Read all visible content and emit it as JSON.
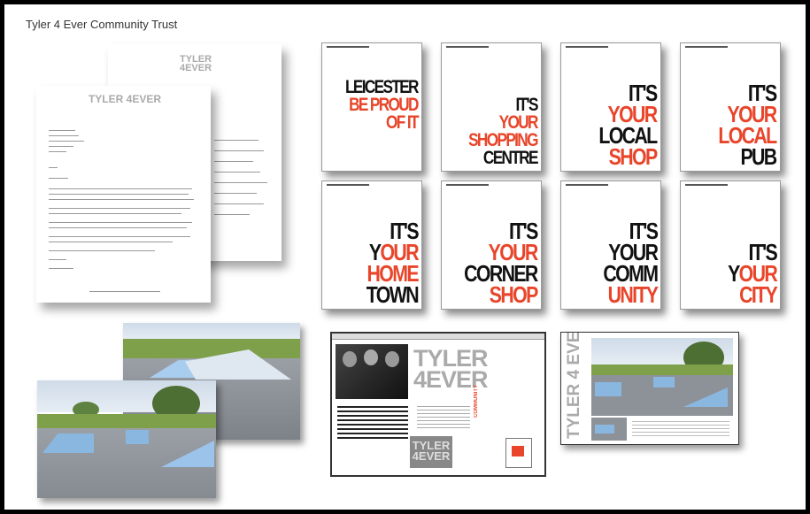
{
  "board": {
    "title": "Tyler 4 Ever Community Trust"
  },
  "letterhead": {
    "logo_line1": "TYLER",
    "logo_line2": "4EVER"
  },
  "posters": [
    {
      "lines": [
        {
          "text": "LEICESTER",
          "color": "black"
        },
        {
          "text": "BE PROUD",
          "color": "red"
        },
        {
          "text": "OF IT",
          "color": "red"
        }
      ],
      "small": true
    },
    {
      "lines": [
        {
          "text": "IT'S",
          "color": "black"
        },
        {
          "text": "YOUR",
          "color": "red"
        },
        {
          "text": "SHOPPING",
          "color": "red"
        },
        {
          "text": "CENTRE",
          "color": "black"
        }
      ],
      "small": true
    },
    {
      "lines": [
        {
          "text": "IT'S",
          "color": "black"
        },
        {
          "text": "YOUR",
          "color": "red"
        },
        {
          "text": "LOCAL",
          "color": "black"
        },
        {
          "text": "SHOP",
          "color": "red"
        }
      ],
      "small": false
    },
    {
      "lines": [
        {
          "text": "IT'S",
          "color": "black"
        },
        {
          "text": "YOUR",
          "color": "red"
        },
        {
          "text": "LOCAL",
          "color": "red"
        },
        {
          "text": "PUB",
          "color": "black"
        }
      ],
      "small": false
    },
    {
      "lines": [
        {
          "text": "IT'S",
          "color": "black"
        },
        {
          "text": "YOUR",
          "color": "mixed",
          "black": "Y",
          "red": "OUR"
        },
        {
          "text": "HOME",
          "color": "red"
        },
        {
          "text": "TOWN",
          "color": "black"
        }
      ],
      "small": false
    },
    {
      "lines": [
        {
          "text": "IT'S",
          "color": "black"
        },
        {
          "text": "YOUR",
          "color": "red"
        },
        {
          "text": "CORNER",
          "color": "black"
        },
        {
          "text": "SHOP",
          "color": "red"
        }
      ],
      "small": false
    },
    {
      "lines": [
        {
          "text": "IT'S",
          "color": "black"
        },
        {
          "text": "YOUR",
          "color": "black"
        },
        {
          "text": "COMM",
          "color": "black"
        },
        {
          "text": "UNITY",
          "color": "red"
        }
      ],
      "small": false
    },
    {
      "lines": [
        {
          "text": "IT'S",
          "color": "black"
        },
        {
          "text": "YOUR",
          "color": "mixed",
          "black": "Y",
          "red": "OUR"
        },
        {
          "text": "CITY",
          "color": "red"
        }
      ],
      "small": false
    }
  ],
  "website": {
    "logo_line1": "TYLER",
    "logo_line2": "4EVER",
    "tagline": "COMMUNITY",
    "badge_line1": "TYLER",
    "badge_line2": "4EVER"
  },
  "flyer": {
    "vertical_logo": "TYLER 4 EVER"
  },
  "colors": {
    "accent_red": "#e8452a",
    "ink": "#111111",
    "grey_logo": "#aaaaaa",
    "ramp_blue": "#8ab7e0"
  }
}
